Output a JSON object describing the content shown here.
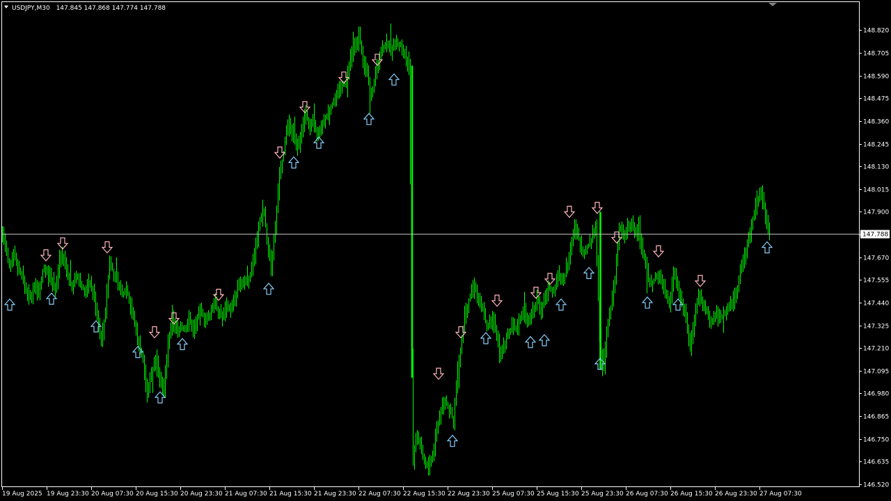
{
  "header": {
    "symbol_timeframe": "USDJPY,M30",
    "ohlc": "147.845 147.868 147.774 147.788"
  },
  "current_price_label": "147.788",
  "colors": {
    "background": "#000000",
    "frame": "#ffffff",
    "candle": "#00ff00",
    "price_line": "#c0c0c0",
    "arrow_down": "#ffb6c1",
    "arrow_up": "#87cefa",
    "text": "#ffffff"
  },
  "chart_data": {
    "type": "candlestick",
    "symbol": "USDJPY",
    "timeframe": "M30",
    "ylim": [
      146.52,
      148.86
    ],
    "current_price": 147.788,
    "y_ticks": [
      "148.820",
      "148.705",
      "148.590",
      "148.475",
      "148.360",
      "148.245",
      "148.130",
      "148.015",
      "147.900",
      "147.785",
      "147.670",
      "147.555",
      "147.440",
      "147.325",
      "147.210",
      "147.095",
      "146.980",
      "146.865",
      "146.750",
      "146.635",
      "146.520"
    ],
    "x_ticks": [
      "19 Aug 2025",
      "19 Aug 23:30",
      "20 Aug 07:30",
      "20 Aug 15:30",
      "20 Aug 23:30",
      "21 Aug 07:30",
      "21 Aug 15:30",
      "21 Aug 23:30",
      "22 Aug 07:30",
      "22 Aug 15:30",
      "22 Aug 23:30",
      "25 Aug 07:30",
      "25 Aug 15:30",
      "25 Aug 23:30",
      "26 Aug 07:30",
      "26 Aug 15:30",
      "26 Aug 23:30",
      "27 Aug 07:30"
    ],
    "price_path": [
      [
        0,
        147.75
      ],
      [
        4,
        147.8
      ],
      [
        9,
        147.7
      ],
      [
        14,
        147.62
      ],
      [
        20,
        147.7
      ],
      [
        26,
        147.62
      ],
      [
        32,
        147.58
      ],
      [
        38,
        147.5
      ],
      [
        44,
        147.46
      ],
      [
        50,
        147.52
      ],
      [
        56,
        147.5
      ],
      [
        62,
        147.6
      ],
      [
        68,
        147.62
      ],
      [
        74,
        147.56
      ],
      [
        80,
        147.5
      ],
      [
        86,
        147.66
      ],
      [
        92,
        147.68
      ],
      [
        98,
        147.58
      ],
      [
        104,
        147.52
      ],
      [
        110,
        147.58
      ],
      [
        116,
        147.54
      ],
      [
        122,
        147.5
      ],
      [
        128,
        147.54
      ],
      [
        134,
        147.5
      ],
      [
        140,
        147.38
      ],
      [
        146,
        147.24
      ],
      [
        152,
        147.4
      ],
      [
        158,
        147.66
      ],
      [
        164,
        147.58
      ],
      [
        170,
        147.54
      ],
      [
        176,
        147.48
      ],
      [
        182,
        147.52
      ],
      [
        188,
        147.42
      ],
      [
        194,
        147.34
      ],
      [
        200,
        147.22
      ],
      [
        206,
        147.14
      ],
      [
        212,
        146.98
      ],
      [
        218,
        147.08
      ],
      [
        224,
        147.16
      ],
      [
        230,
        147.06
      ],
      [
        236,
        147.0
      ],
      [
        242,
        147.24
      ],
      [
        248,
        147.36
      ],
      [
        254,
        147.3
      ],
      [
        260,
        147.32
      ],
      [
        266,
        147.3
      ],
      [
        272,
        147.36
      ],
      [
        278,
        147.3
      ],
      [
        284,
        147.36
      ],
      [
        290,
        147.4
      ],
      [
        296,
        147.34
      ],
      [
        302,
        147.38
      ],
      [
        308,
        147.44
      ],
      [
        314,
        147.4
      ],
      [
        320,
        147.36
      ],
      [
        326,
        147.42
      ],
      [
        332,
        147.4
      ],
      [
        338,
        147.46
      ],
      [
        344,
        147.54
      ],
      [
        350,
        147.56
      ],
      [
        356,
        147.54
      ],
      [
        362,
        147.6
      ],
      [
        368,
        147.72
      ],
      [
        374,
        147.86
      ],
      [
        380,
        147.9
      ],
      [
        386,
        147.7
      ],
      [
        390,
        147.62
      ],
      [
        396,
        147.84
      ],
      [
        402,
        148.08
      ],
      [
        408,
        148.2
      ],
      [
        414,
        148.34
      ],
      [
        420,
        148.3
      ],
      [
        426,
        148.22
      ],
      [
        432,
        148.26
      ],
      [
        438,
        148.4
      ],
      [
        444,
        148.36
      ],
      [
        450,
        148.34
      ],
      [
        456,
        148.3
      ],
      [
        462,
        148.34
      ],
      [
        468,
        148.38
      ],
      [
        474,
        148.42
      ],
      [
        480,
        148.46
      ],
      [
        486,
        148.5
      ],
      [
        492,
        148.54
      ],
      [
        498,
        148.56
      ],
      [
        504,
        148.68
      ],
      [
        510,
        148.74
      ],
      [
        516,
        148.8
      ],
      [
        522,
        148.66
      ],
      [
        528,
        148.6
      ],
      [
        532,
        148.5
      ],
      [
        536,
        148.52
      ],
      [
        540,
        148.6
      ],
      [
        546,
        148.68
      ],
      [
        552,
        148.74
      ],
      [
        558,
        148.76
      ],
      [
        564,
        148.72
      ],
      [
        570,
        148.76
      ],
      [
        576,
        148.74
      ],
      [
        582,
        148.7
      ],
      [
        588,
        148.64
      ],
      [
        591,
        147.78
      ],
      [
        593,
        146.6
      ],
      [
        598,
        146.76
      ],
      [
        604,
        146.72
      ],
      [
        610,
        146.64
      ],
      [
        616,
        146.6
      ],
      [
        622,
        146.66
      ],
      [
        628,
        146.8
      ],
      [
        634,
        146.9
      ],
      [
        640,
        146.94
      ],
      [
        646,
        146.9
      ],
      [
        652,
        146.84
      ],
      [
        658,
        147.1
      ],
      [
        664,
        147.26
      ],
      [
        670,
        147.4
      ],
      [
        676,
        147.48
      ],
      [
        682,
        147.52
      ],
      [
        688,
        147.46
      ],
      [
        694,
        147.4
      ],
      [
        700,
        147.32
      ],
      [
        706,
        147.36
      ],
      [
        712,
        147.32
      ],
      [
        718,
        147.18
      ],
      [
        724,
        147.22
      ],
      [
        730,
        147.28
      ],
      [
        736,
        147.32
      ],
      [
        742,
        147.3
      ],
      [
        748,
        147.36
      ],
      [
        754,
        147.4
      ],
      [
        760,
        147.34
      ],
      [
        766,
        147.38
      ],
      [
        772,
        147.46
      ],
      [
        778,
        147.4
      ],
      [
        784,
        147.48
      ],
      [
        790,
        147.52
      ],
      [
        796,
        147.5
      ],
      [
        802,
        147.58
      ],
      [
        808,
        147.54
      ],
      [
        814,
        147.6
      ],
      [
        820,
        147.72
      ],
      [
        826,
        147.82
      ],
      [
        832,
        147.76
      ],
      [
        838,
        147.7
      ],
      [
        844,
        147.72
      ],
      [
        850,
        147.76
      ],
      [
        856,
        147.84
      ],
      [
        862,
        147.26
      ],
      [
        866,
        147.1
      ],
      [
        872,
        147.28
      ],
      [
        878,
        147.42
      ],
      [
        884,
        147.56
      ],
      [
        890,
        147.82
      ],
      [
        896,
        147.78
      ],
      [
        902,
        147.82
      ],
      [
        908,
        147.84
      ],
      [
        914,
        147.8
      ],
      [
        920,
        147.76
      ],
      [
        926,
        147.66
      ],
      [
        932,
        147.56
      ],
      [
        938,
        147.54
      ],
      [
        944,
        147.58
      ],
      [
        950,
        147.56
      ],
      [
        956,
        147.5
      ],
      [
        962,
        147.42
      ],
      [
        968,
        147.6
      ],
      [
        974,
        147.54
      ],
      [
        980,
        147.44
      ],
      [
        986,
        147.36
      ],
      [
        992,
        147.22
      ],
      [
        998,
        147.36
      ],
      [
        1004,
        147.48
      ],
      [
        1010,
        147.44
      ],
      [
        1016,
        147.4
      ],
      [
        1022,
        147.34
      ],
      [
        1028,
        147.38
      ],
      [
        1034,
        147.36
      ],
      [
        1040,
        147.38
      ],
      [
        1046,
        147.4
      ],
      [
        1052,
        147.44
      ],
      [
        1058,
        147.48
      ],
      [
        1064,
        147.6
      ],
      [
        1070,
        147.68
      ],
      [
        1076,
        147.76
      ],
      [
        1082,
        147.86
      ],
      [
        1088,
        147.96
      ],
      [
        1094,
        148.0
      ],
      [
        1098,
        147.92
      ],
      [
        1102,
        147.84
      ],
      [
        1105,
        147.79
      ]
    ],
    "down_arrows": [
      [
        66,
        147.68
      ],
      [
        90,
        147.74
      ],
      [
        154,
        147.72
      ],
      [
        222,
        147.29
      ],
      [
        250,
        147.36
      ],
      [
        314,
        147.48
      ],
      [
        402,
        148.2
      ],
      [
        438,
        148.43
      ],
      [
        494,
        148.58
      ],
      [
        542,
        148.67
      ],
      [
        630,
        147.08
      ],
      [
        662,
        147.29
      ],
      [
        714,
        147.45
      ],
      [
        770,
        147.49
      ],
      [
        790,
        147.56
      ],
      [
        818,
        147.9
      ],
      [
        858,
        147.92
      ],
      [
        886,
        147.77
      ],
      [
        946,
        147.7
      ],
      [
        1006,
        147.55
      ]
    ],
    "up_arrows": [
      [
        14,
        147.43
      ],
      [
        74,
        147.46
      ],
      [
        138,
        147.32
      ],
      [
        198,
        147.19
      ],
      [
        230,
        146.96
      ],
      [
        262,
        147.23
      ],
      [
        386,
        147.51
      ],
      [
        422,
        148.15
      ],
      [
        458,
        148.25
      ],
      [
        530,
        148.37
      ],
      [
        566,
        148.57
      ],
      [
        650,
        146.74
      ],
      [
        698,
        147.26
      ],
      [
        762,
        147.24
      ],
      [
        782,
        147.25
      ],
      [
        806,
        147.43
      ],
      [
        846,
        147.59
      ],
      [
        862,
        147.13
      ],
      [
        930,
        147.44
      ],
      [
        974,
        147.43
      ],
      [
        1102,
        147.72
      ]
    ]
  }
}
